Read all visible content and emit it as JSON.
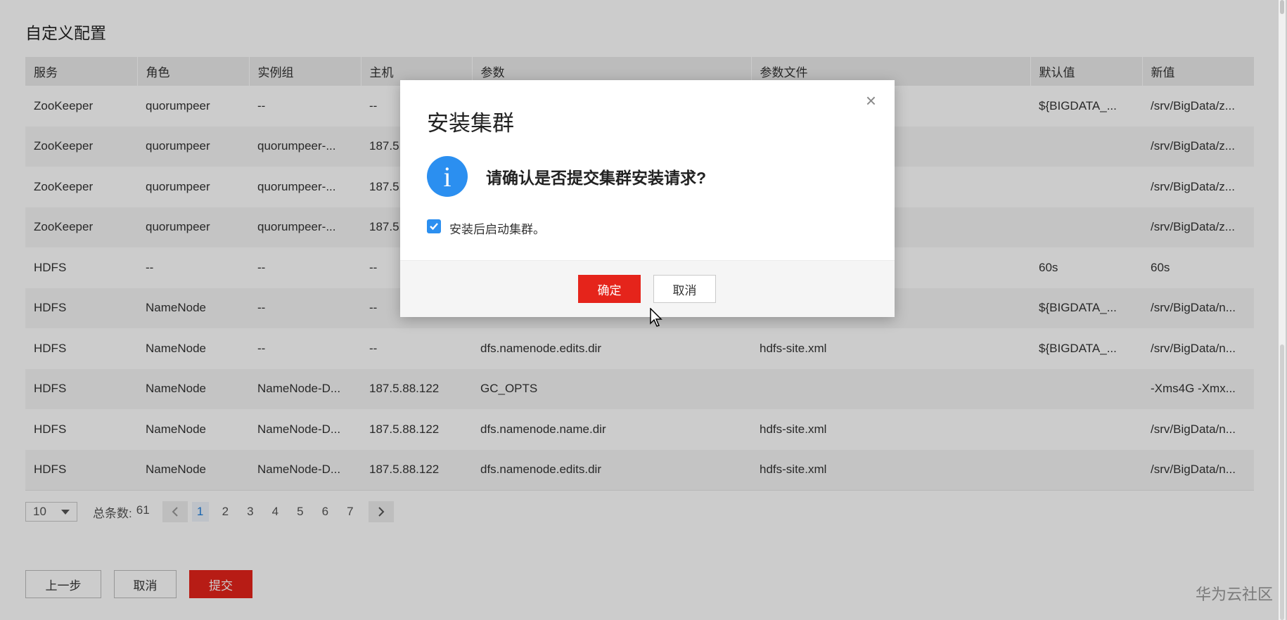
{
  "section_title": "自定义配置",
  "table": {
    "headers": [
      "服务",
      "角色",
      "实例组",
      "主机",
      "参数",
      "参数文件",
      "默认值",
      "新值"
    ],
    "rows": [
      [
        "ZooKeeper",
        "quorumpeer",
        "--",
        "--",
        "",
        "",
        "${BIGDATA_...",
        "/srv/BigData/z..."
      ],
      [
        "ZooKeeper",
        "quorumpeer",
        "quorumpeer-...",
        "187.5",
        "",
        "",
        "",
        "/srv/BigData/z..."
      ],
      [
        "ZooKeeper",
        "quorumpeer",
        "quorumpeer-...",
        "187.5",
        "",
        "",
        "",
        "/srv/BigData/z..."
      ],
      [
        "ZooKeeper",
        "quorumpeer",
        "quorumpeer-...",
        "187.5",
        "",
        "",
        "",
        "/srv/BigData/z..."
      ],
      [
        "HDFS",
        "--",
        "--",
        "--",
        "",
        "",
        "60s",
        "60s"
      ],
      [
        "HDFS",
        "NameNode",
        "--",
        "--",
        "",
        "",
        "${BIGDATA_...",
        "/srv/BigData/n..."
      ],
      [
        "HDFS",
        "NameNode",
        "--",
        "--",
        "dfs.namenode.edits.dir",
        "hdfs-site.xml",
        "${BIGDATA_...",
        "/srv/BigData/n..."
      ],
      [
        "HDFS",
        "NameNode",
        "NameNode-D...",
        "187.5.88.122",
        "GC_OPTS",
        "",
        "",
        "-Xms4G -Xmx..."
      ],
      [
        "HDFS",
        "NameNode",
        "NameNode-D...",
        "187.5.88.122",
        "dfs.namenode.name.dir",
        "hdfs-site.xml",
        "",
        "/srv/BigData/n..."
      ],
      [
        "HDFS",
        "NameNode",
        "NameNode-D...",
        "187.5.88.122",
        "dfs.namenode.edits.dir",
        "hdfs-site.xml",
        "",
        "/srv/BigData/n..."
      ]
    ]
  },
  "pagination": {
    "page_size": "10",
    "total_label": "总条数:",
    "total_value": "61",
    "pages": [
      "1",
      "2",
      "3",
      "4",
      "5",
      "6",
      "7"
    ],
    "current_page": "1"
  },
  "buttons": {
    "prev": "上一步",
    "cancel": "取消",
    "submit": "提交"
  },
  "dialog": {
    "title": "安装集群",
    "close": "×",
    "message": "请确认是否提交集群安装请求?",
    "checkbox_label": "安装后启动集群。",
    "checkbox_checked": true,
    "ok": "确定",
    "cancel": "取消"
  },
  "watermark": "华为云社区",
  "colors": {
    "primary_red": "#e5241b",
    "info_blue": "#2b8ff0",
    "active_page": "#1f7fde"
  }
}
